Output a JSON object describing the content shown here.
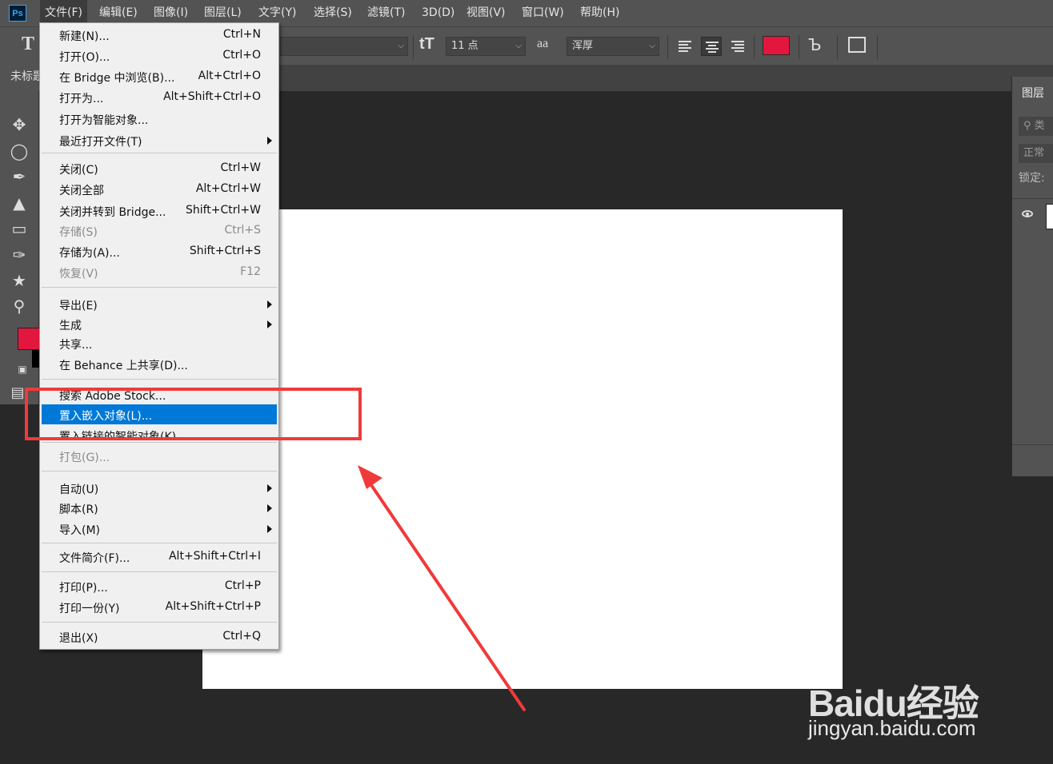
{
  "app_logo": "Ps",
  "menubar": [
    {
      "label": "文件(F)",
      "active": true
    },
    {
      "label": "编辑(E)"
    },
    {
      "label": "图像(I)"
    },
    {
      "label": "图层(L)"
    },
    {
      "label": "文字(Y)"
    },
    {
      "label": "选择(S)"
    },
    {
      "label": "滤镜(T)"
    },
    {
      "label": "3D(D)"
    },
    {
      "label": "视图(V)"
    },
    {
      "label": "窗口(W)"
    },
    {
      "label": "帮助(H)"
    }
  ],
  "options_bar": {
    "tool_icon": "T",
    "font_size_icon": "tT",
    "font_size": "11 点",
    "aa_icon": "aa",
    "antialias": "浑厚",
    "text_color": "#e3173e"
  },
  "document_tab": "未标题",
  "tools": [
    "move-icon",
    "lasso-icon",
    "eyedropper-icon",
    "stamp-icon",
    "eraser-icon",
    "pen-icon",
    "shape-icon",
    "zoom-icon"
  ],
  "colors": {
    "foreground": "#e3173e",
    "background": "#000000"
  },
  "layers_panel": {
    "tab": "图层",
    "filter_placeholder": "类",
    "blend_mode": "正常",
    "lock_label": "锁定:"
  },
  "file_menu": {
    "items": [
      {
        "label": "新建(N)...",
        "shortcut": "Ctrl+N"
      },
      {
        "label": "打开(O)...",
        "shortcut": "Ctrl+O"
      },
      {
        "label": "在 Bridge 中浏览(B)...",
        "shortcut": "Alt+Ctrl+O"
      },
      {
        "label": "打开为...",
        "shortcut": "Alt+Shift+Ctrl+O"
      },
      {
        "label": "打开为智能对象...",
        "shortcut": ""
      },
      {
        "label": "最近打开文件(T)",
        "shortcut": "",
        "submenu": true
      },
      {
        "label": "关闭(C)",
        "shortcut": "Ctrl+W"
      },
      {
        "label": "关闭全部",
        "shortcut": "Alt+Ctrl+W"
      },
      {
        "label": "关闭并转到 Bridge...",
        "shortcut": "Shift+Ctrl+W"
      },
      {
        "label": "存储(S)",
        "shortcut": "Ctrl+S",
        "disabled": true
      },
      {
        "label": "存储为(A)...",
        "shortcut": "Shift+Ctrl+S"
      },
      {
        "label": "恢复(V)",
        "shortcut": "F12",
        "disabled": true
      },
      {
        "label": "导出(E)",
        "shortcut": "",
        "submenu": true
      },
      {
        "label": "生成",
        "shortcut": "",
        "submenu": true
      },
      {
        "label": "共享...",
        "shortcut": ""
      },
      {
        "label": "在 Behance 上共享(D)...",
        "shortcut": ""
      },
      {
        "label": "搜索 Adobe Stock...",
        "shortcut": ""
      },
      {
        "label": "置入嵌入对象(L)...",
        "shortcut": "",
        "highlighted": true
      },
      {
        "label": "置入链接的智能对象(K)...",
        "shortcut": ""
      },
      {
        "label": "打包(G)...",
        "shortcut": "",
        "disabled": true
      },
      {
        "label": "自动(U)",
        "shortcut": "",
        "submenu": true
      },
      {
        "label": "脚本(R)",
        "shortcut": "",
        "submenu": true
      },
      {
        "label": "导入(M)",
        "shortcut": "",
        "submenu": true
      },
      {
        "label": "文件简介(F)...",
        "shortcut": "Alt+Shift+Ctrl+I"
      },
      {
        "label": "打印(P)...",
        "shortcut": "Ctrl+P"
      },
      {
        "label": "打印一份(Y)",
        "shortcut": "Alt+Shift+Ctrl+P"
      },
      {
        "label": "退出(X)",
        "shortcut": "Ctrl+Q"
      }
    ]
  },
  "annotation_color": "#f03a3a",
  "watermark": {
    "logo": "Baidu经验",
    "url": "jingyan.baidu.com"
  }
}
